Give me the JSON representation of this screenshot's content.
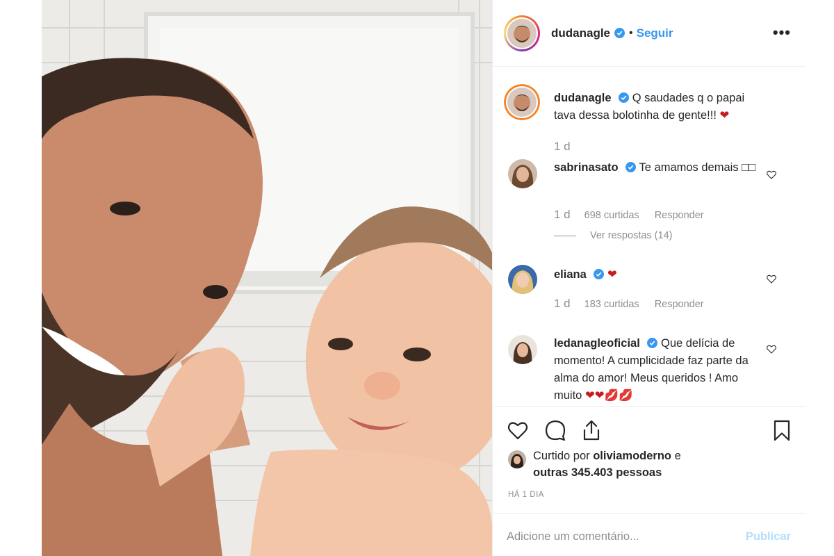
{
  "post": {
    "author": "dudanagle",
    "follow_label": "Seguir",
    "separator": "•",
    "more_label": "•••"
  },
  "caption": {
    "user": "dudanagle",
    "text": "Q saudades q o papai tava dessa bolotinha de gente!!!",
    "emoji": "❤",
    "age": "1 d"
  },
  "comments": [
    {
      "user": "sabrinasato",
      "text": "Te amamos demais □□",
      "age": "1 d",
      "likes": "698 curtidas",
      "reply_label": "Responder",
      "view_replies": "Ver respostas (14)"
    },
    {
      "user": "eliana",
      "text": "",
      "emoji": "❤",
      "age": "1 d",
      "likes": "183 curtidas",
      "reply_label": "Responder"
    },
    {
      "user": "ledanagleoficial",
      "text": "Que delícia de momento! A cumplicidade faz parte da alma do amor! Meus queridos ! Amo muito",
      "emoji": "❤❤💋💋"
    }
  ],
  "likes_summary": {
    "prefix": "Curtido por",
    "user": "oliviamoderno",
    "middle": "e",
    "others": "outras 345.403 pessoas"
  },
  "timestamp": "HÁ 1 DIA",
  "comment_box": {
    "placeholder": "Adicione um comentário...",
    "publish_label": "Publicar"
  },
  "colors": {
    "link_blue": "#3897f0",
    "publish_disabled": "#b2dffc",
    "muted": "#8e8e8e",
    "heart_red": "#c51d1d"
  },
  "icons": [
    "like-heart-icon",
    "comment-bubble-icon",
    "share-icon",
    "bookmark-icon",
    "verified-badge-icon",
    "small-heart-icon"
  ]
}
